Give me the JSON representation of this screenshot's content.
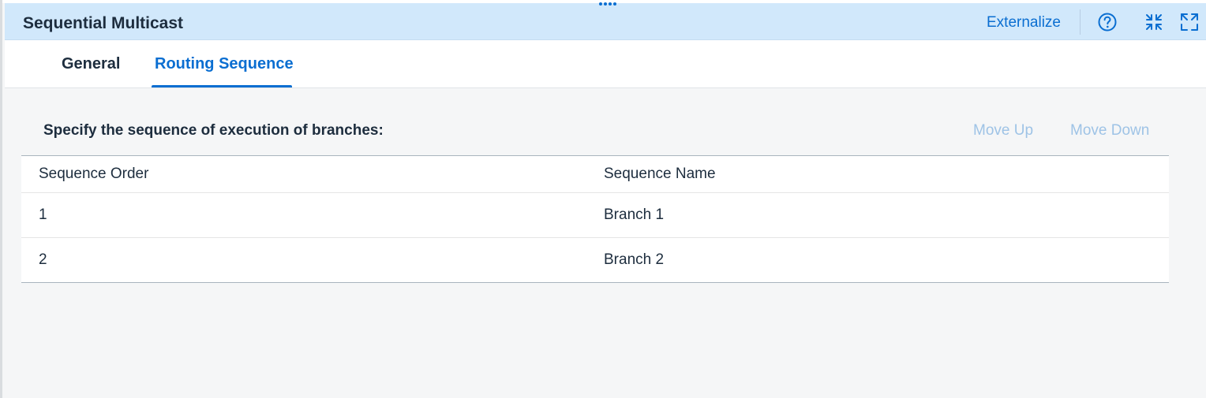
{
  "header": {
    "title": "Sequential Multicast",
    "externalize_label": "Externalize",
    "icons": [
      "help-icon",
      "collapse-icon",
      "expand-icon"
    ],
    "accent_color": "#0a6ed1",
    "background_color": "#d1e8fb"
  },
  "tabs": [
    {
      "label": "General",
      "selected": false
    },
    {
      "label": "Routing Sequence",
      "selected": true
    }
  ],
  "routing": {
    "instructions": "Specify the sequence of execution of branches:",
    "move_up_label": "Move Up",
    "move_down_label": "Move Down",
    "table": {
      "columns": [
        "Sequence Order",
        "Sequence Name"
      ],
      "rows": [
        [
          "1",
          "Branch 1"
        ],
        [
          "2",
          "Branch 2"
        ]
      ]
    }
  }
}
